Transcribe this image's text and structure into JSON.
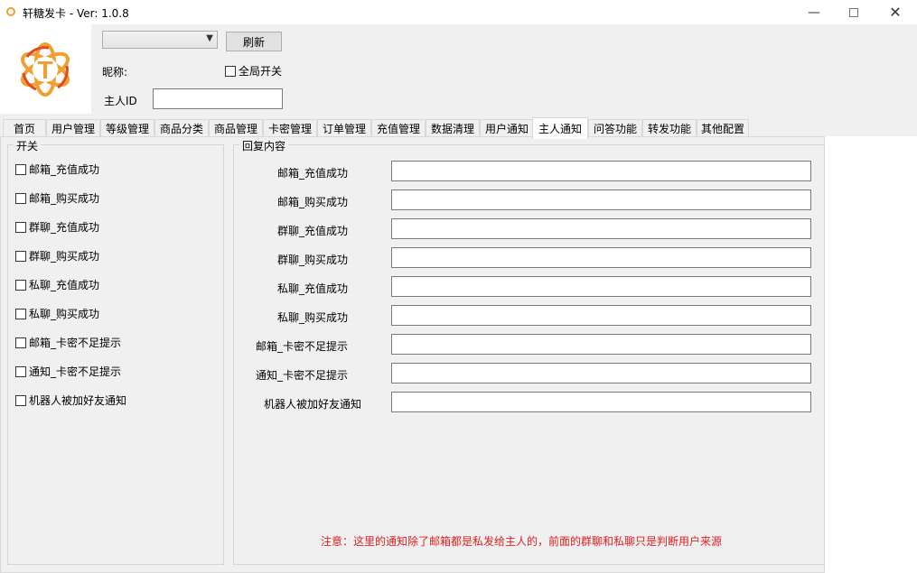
{
  "window": {
    "title": "轩糖发卡 - Ver: 1.0.8",
    "controls": {
      "minimize": "—",
      "maximize": "",
      "close": "✕"
    }
  },
  "header": {
    "logo": {
      "letter": "T",
      "icon": "orange-flower-logo-icon"
    },
    "account_select": {
      "value": ""
    },
    "refresh_label": "刷新",
    "nickname_label": "昵称:",
    "global_toggle_label": "全局开关",
    "owner_id_label": "主人ID",
    "owner_id_value": ""
  },
  "tabs": [
    {
      "label": "首页"
    },
    {
      "label": "用户管理"
    },
    {
      "label": "等级管理"
    },
    {
      "label": "商品分类"
    },
    {
      "label": "商品管理"
    },
    {
      "label": "卡密管理"
    },
    {
      "label": "订单管理"
    },
    {
      "label": "充值管理"
    },
    {
      "label": "数据清理"
    },
    {
      "label": "用户通知"
    },
    {
      "label": "主人通知",
      "active": true
    },
    {
      "label": "问答功能"
    },
    {
      "label": "转发功能"
    },
    {
      "label": "其他配置"
    }
  ],
  "switch_group": {
    "title": "开关",
    "items": [
      {
        "label": "邮箱_充值成功",
        "checked": false
      },
      {
        "label": "邮箱_购买成功",
        "checked": false
      },
      {
        "label": "群聊_充值成功",
        "checked": false
      },
      {
        "label": "群聊_购买成功",
        "checked": false
      },
      {
        "label": "私聊_充值成功",
        "checked": false
      },
      {
        "label": "私聊_购买成功",
        "checked": false
      },
      {
        "label": "邮箱_卡密不足提示",
        "checked": false
      },
      {
        "label": "通知_卡密不足提示",
        "checked": false
      },
      {
        "label": "机器人被加好友通知",
        "checked": false
      }
    ]
  },
  "reply_group": {
    "title": "回复内容",
    "items": [
      {
        "label": "邮箱_充值成功",
        "value": ""
      },
      {
        "label": "邮箱_购买成功",
        "value": ""
      },
      {
        "label": "群聊_充值成功",
        "value": ""
      },
      {
        "label": "群聊_购买成功",
        "value": ""
      },
      {
        "label": "私聊_充值成功",
        "value": ""
      },
      {
        "label": "私聊_购买成功",
        "value": ""
      },
      {
        "label": "邮箱_卡密不足提示",
        "value": ""
      },
      {
        "label": "通知_卡密不足提示",
        "value": ""
      },
      {
        "label": "机器人被加好友通知",
        "value": ""
      }
    ],
    "note": "注意：这里的通知除了邮箱都是私发给主人的，前面的群聊和私聊只是判断用户来源"
  },
  "colors": {
    "accent_orange": "#f0a030",
    "logo_red": "#e04a20",
    "note_red": "#e02020",
    "window_bg": "#f0f0f0"
  }
}
